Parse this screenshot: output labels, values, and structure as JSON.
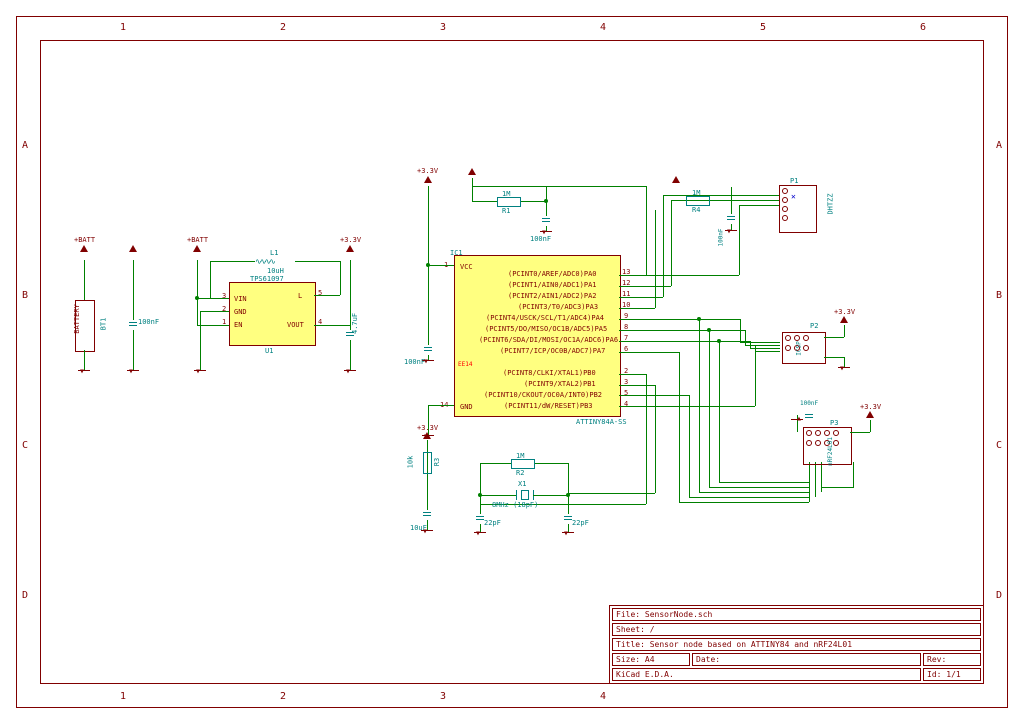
{
  "meta": {
    "file": "File: SensorNode.sch",
    "sheet": "Sheet: /",
    "title": "Title: Sensor node based on ATTINY84 and nRF24L01",
    "size": "Size: A4",
    "date": "Date:",
    "rev": "Rev:",
    "tool": "KiCad E.D.A.",
    "id": "Id: 1/1"
  },
  "marks": [
    "A",
    "B",
    "C",
    "D",
    "1",
    "2",
    "3",
    "4",
    "5",
    "6"
  ],
  "u1": {
    "ref": "U1",
    "name": "TPS61097",
    "pins": {
      "vin": "VIN",
      "gnd": "GND",
      "en": "EN",
      "l": "L",
      "vout": "VOUT"
    },
    "nums": {
      "p1": "1",
      "p2": "2",
      "p3": "3",
      "p4": "4",
      "p5": "5"
    }
  },
  "ic": {
    "ref": "IC1",
    "part": "ATTINY84A-SS",
    "ee": "EE14",
    "vcc": "VCC",
    "gnd": "GND",
    "pins": [
      "(PCINT0/AREF/ADC0)PA0",
      "(PCINT1/AIN0/ADC1)PA1",
      "(PCINT2/AIN1/ADC2)PA2",
      "(PCINT3/T0/ADC3)PA3",
      "(PCINT4/USCK/SCL/T1/ADC4)PA4",
      "(PCINT5/DO/MISO/OC1B/ADC5)PA5",
      "(PCINT6/SDA/DI/MOSI/OC1A/ADC6)PA6",
      "(PCINT7/ICP/OC0B/ADC7)PA7",
      "(PCINT8/CLKI/XTAL1)PB0",
      "(PCINT9/XTAL2)PB1",
      "(PCINT10/CKOUT/OC0A/INT0)PB2",
      "(PCINT11/dW/RESET)PB3"
    ],
    "nums": [
      "13",
      "12",
      "11",
      "10",
      "9",
      "8",
      "7",
      "6",
      "2",
      "3",
      "5",
      "4"
    ],
    "left": {
      "p1": "1",
      "p14": "14"
    }
  },
  "parts": {
    "l1": {
      "ref": "L1",
      "val": "10uH"
    },
    "bt1": {
      "ref": "BT1",
      "lbl": "BATTERY",
      "vbat": "+BATT"
    },
    "c5": "100nF",
    "c6": "100nF",
    "c7": "100nF",
    "c8": "100nF",
    "c9": "100nF",
    "c1": "10uF",
    "c2": "4.7uF",
    "c3": "22pF",
    "c4": "22pF",
    "r1": {
      "ref": "1M",
      "lbl": "R1"
    },
    "r2": {
      "ref": "1M",
      "lbl": "R2"
    },
    "r3": {
      "ref": "10k",
      "lbl": "R3"
    },
    "r4": {
      "ref": "1M",
      "lbl": "R4"
    },
    "x1": {
      "ref": "X1",
      "val": "8MHz (18pF)"
    },
    "v33": "+3.3V"
  },
  "conns": {
    "p1": {
      "ref": "P1",
      "lbl": "DHTZZ"
    },
    "p2": {
      "ref": "P2",
      "lbl": "ICSP"
    },
    "p3": {
      "ref": "P3",
      "lbl": "nRF24L01"
    }
  }
}
